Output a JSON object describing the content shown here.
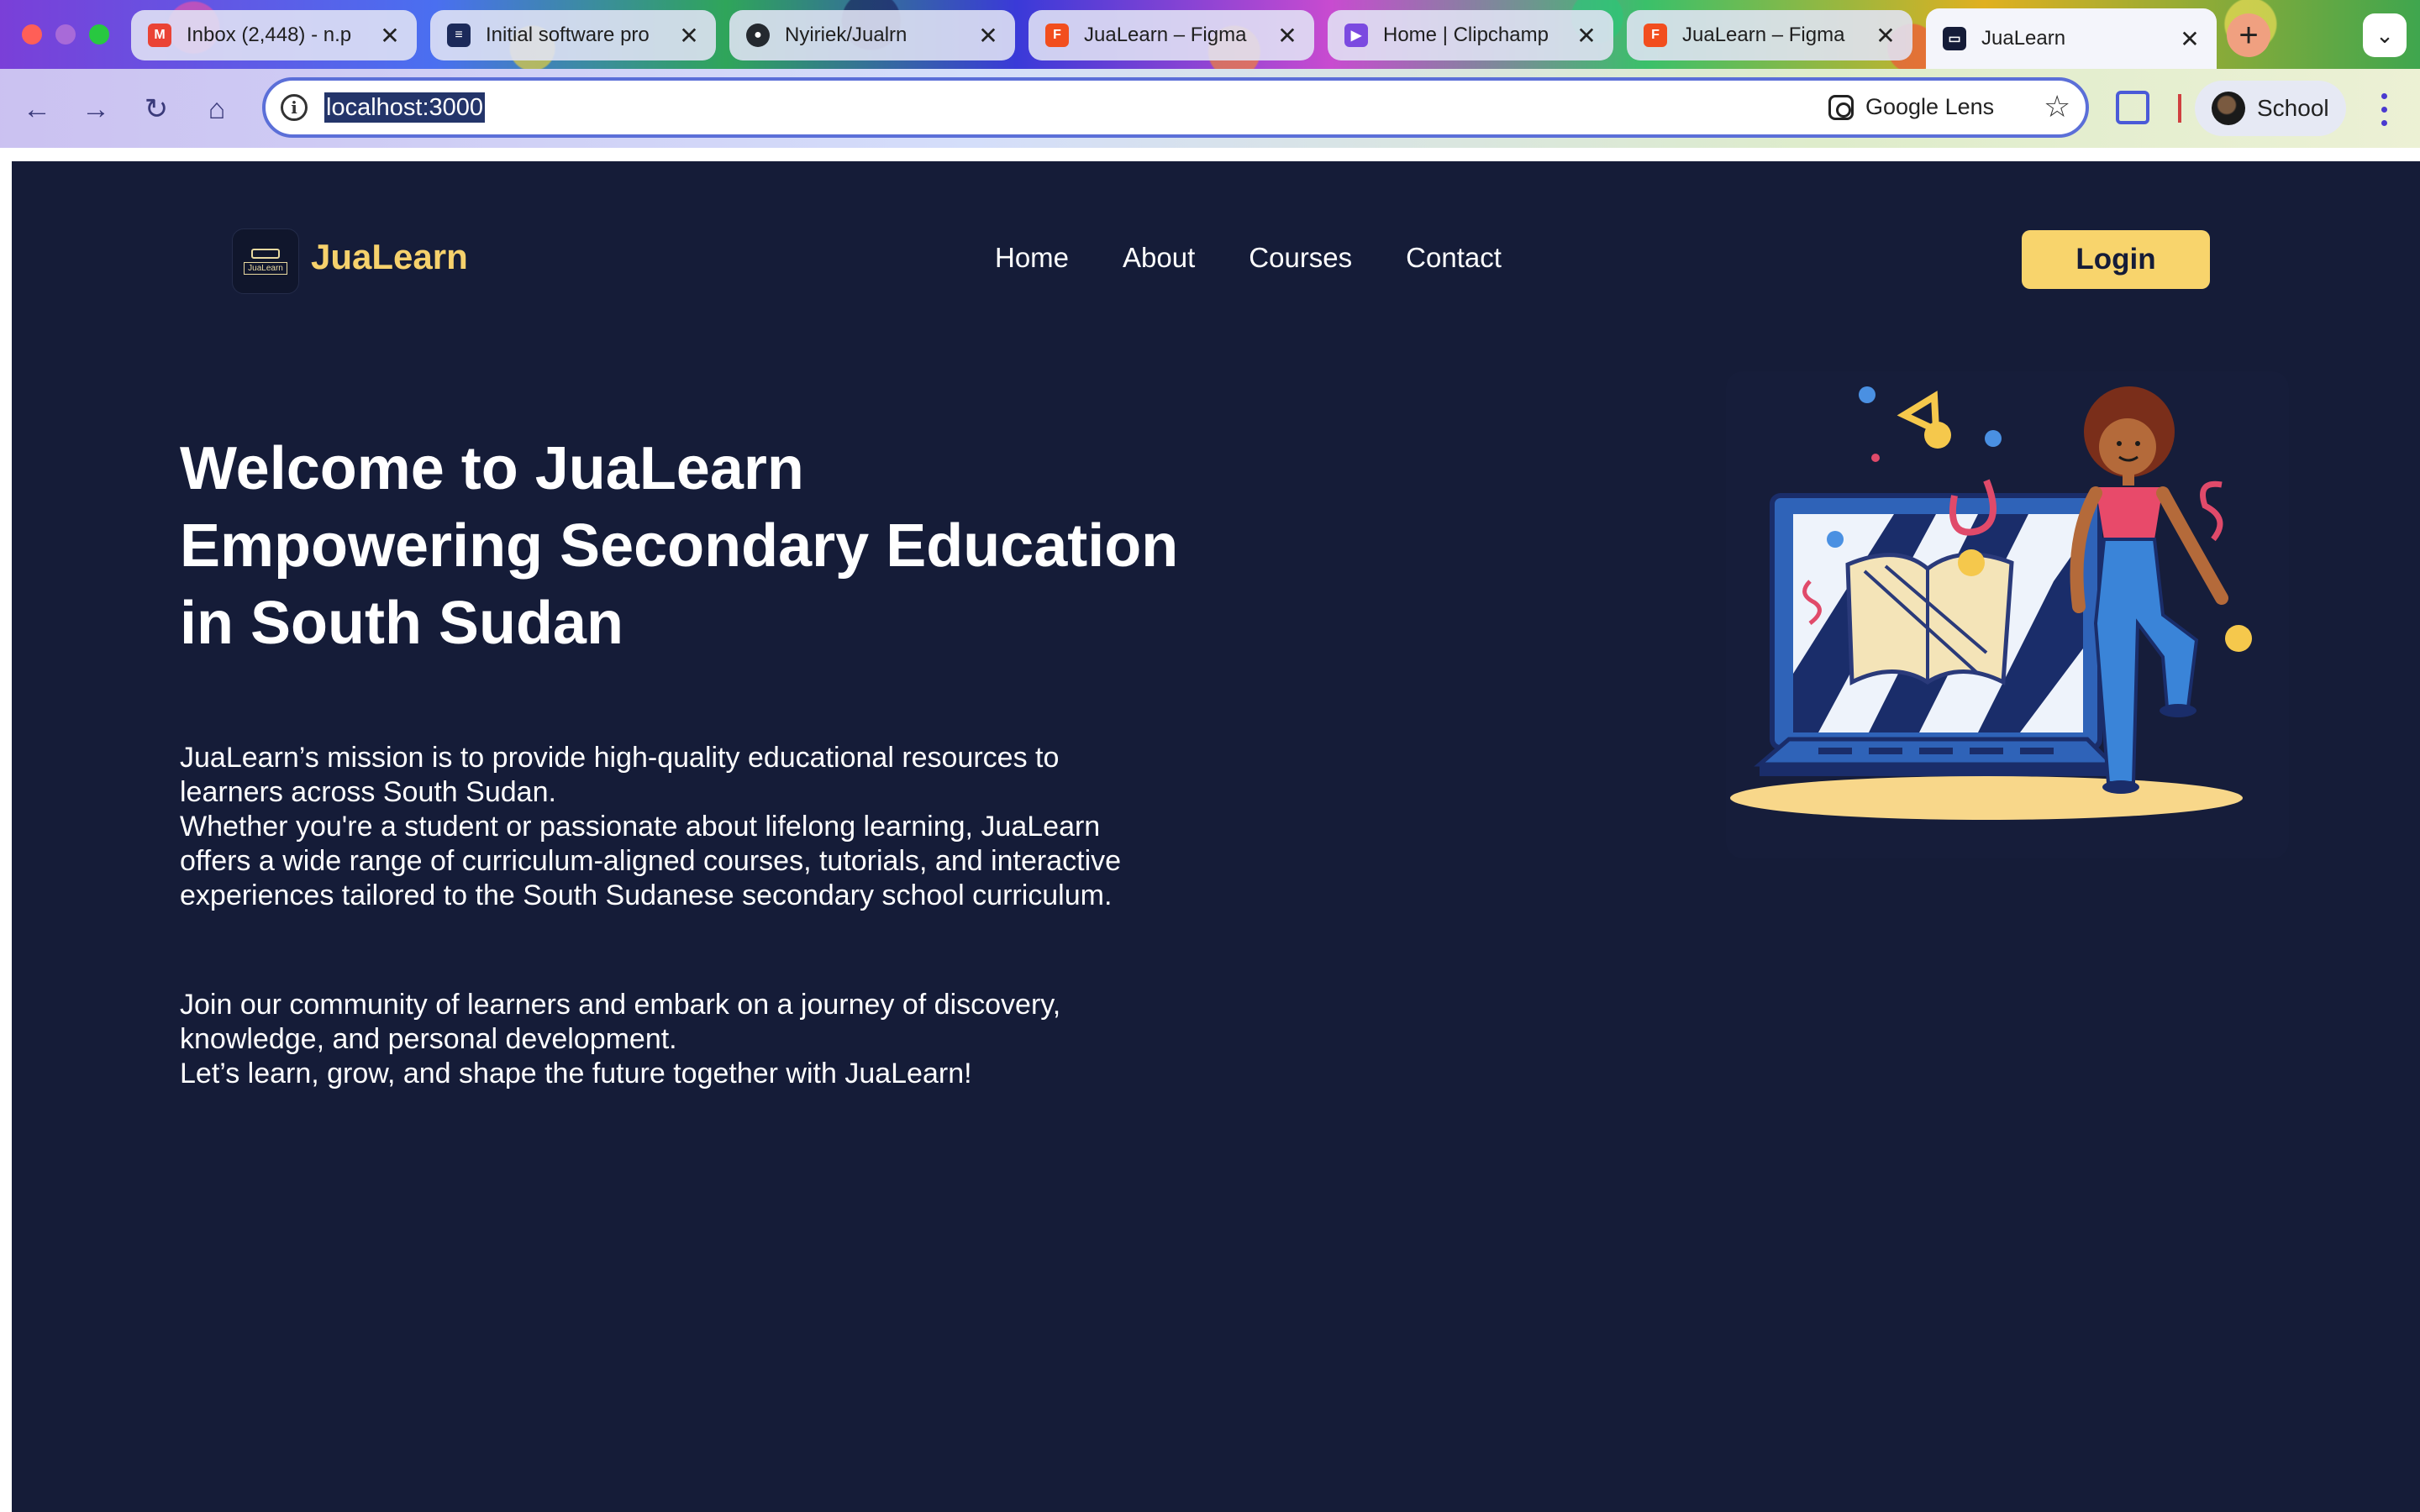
{
  "browser": {
    "tabs": [
      {
        "title": "Inbox (2,448) - n.p",
        "favicon_color": "#ea4335",
        "active": false
      },
      {
        "title": "Initial software pro",
        "favicon_color": "#1c2a5a",
        "active": false
      },
      {
        "title": "Nyiriek/Jualrn",
        "favicon_color": "#24292f",
        "active": false
      },
      {
        "title": "JuaLearn – Figma",
        "favicon_color": "#f24e1e",
        "active": false
      },
      {
        "title": "Home | Clipchamp",
        "favicon_color": "#7b4ae0",
        "active": false
      },
      {
        "title": "JuaLearn – Figma",
        "favicon_color": "#f24e1e",
        "active": false
      },
      {
        "title": "JuaLearn",
        "favicon_color": "#151c38",
        "active": true
      }
    ],
    "tab_close_glyph": "✕",
    "new_tab_glyph": "+",
    "tab_search_glyph": "⌄",
    "address": "localhost:3000",
    "lens_label": "Google Lens",
    "profile_name": "School"
  },
  "site": {
    "brand": "JuaLearn",
    "logo_small_text": "JuaLearn",
    "nav": [
      {
        "label": "Home"
      },
      {
        "label": "About"
      },
      {
        "label": "Courses"
      },
      {
        "label": "Contact"
      }
    ],
    "login_label": "Login",
    "hero": {
      "title_lines": [
        "Welcome to JuaLearn",
        "Empowering Secondary Education",
        "in South Sudan"
      ],
      "paragraph1_lines": [
        "JuaLearn’s mission is to provide high-quality educational resources to",
        "learners across South Sudan.",
        "Whether you're a student or passionate about lifelong learning, JuaLearn",
        "offers a wide range of curriculum-aligned courses, tutorials, and interactive",
        "experiences tailored to the South Sudanese secondary school curriculum."
      ],
      "paragraph2_lines": [
        "Join our community of learners and embark on a journey of discovery,",
        "knowledge, and personal development.",
        "Let’s learn, grow, and shape the future together with JuaLearn!"
      ]
    },
    "colors": {
      "background": "#151c38",
      "accent": "#f6d16c",
      "button": "#f8d46c",
      "text": "#ffffff"
    }
  }
}
